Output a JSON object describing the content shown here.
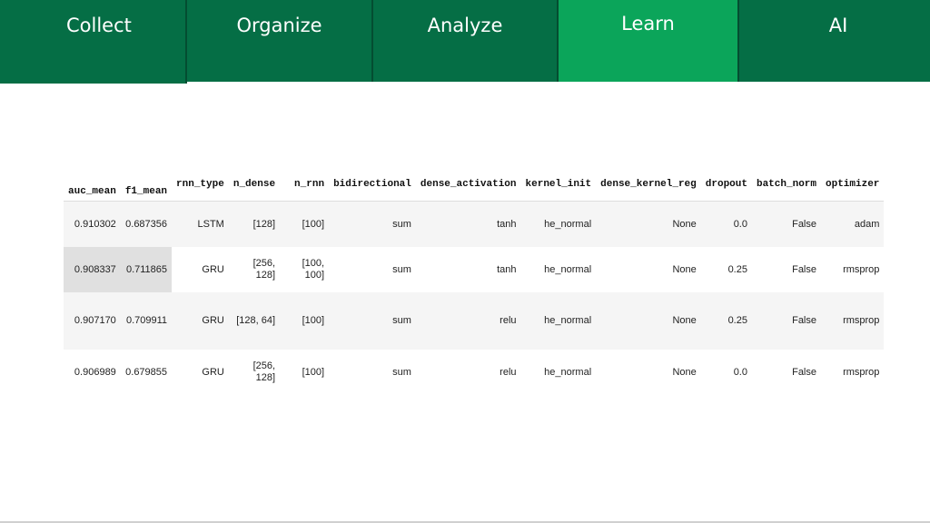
{
  "nav": {
    "tabs": [
      {
        "label": "Collect"
      },
      {
        "label": "Organize"
      },
      {
        "label": "Analyze"
      },
      {
        "label": "Learn"
      },
      {
        "label": "AI"
      }
    ],
    "active_tab": "Learn",
    "colors": {
      "tab_bg": "#056e45",
      "tab_active_bg": "#0ba55a",
      "text": "#ffffff"
    }
  },
  "table": {
    "columns": [
      "auc_mean",
      "f1_mean",
      "rnn_type",
      "n_dense",
      "n_rnn",
      "bidirectional",
      "dense_activation",
      "kernel_init",
      "dense_kernel_reg",
      "dropout",
      "batch_norm",
      "optimizer"
    ],
    "rows": [
      {
        "auc_mean": "0.910302",
        "f1_mean": "0.687356",
        "rnn_type": "LSTM",
        "n_dense": [
          "[128]"
        ],
        "n_rnn": [
          "[100]"
        ],
        "bidirectional": "sum",
        "dense_activation": "tanh",
        "kernel_init": "he_normal",
        "dense_kernel_reg": "None",
        "dropout": "0.0",
        "batch_norm": "False",
        "optimizer": "adam"
      },
      {
        "auc_mean": "0.908337",
        "f1_mean": "0.711865",
        "rnn_type": "GRU",
        "n_dense": [
          "[256,",
          "128]"
        ],
        "n_rnn": [
          "[100,",
          "100]"
        ],
        "bidirectional": "sum",
        "dense_activation": "tanh",
        "kernel_init": "he_normal",
        "dense_kernel_reg": "None",
        "dropout": "0.25",
        "batch_norm": "False",
        "optimizer": "rmsprop"
      },
      {
        "auc_mean": "0.907170",
        "f1_mean": "0.709911",
        "rnn_type": "GRU",
        "n_dense": [
          "[128, 64]"
        ],
        "n_rnn": [
          "[100]"
        ],
        "bidirectional": "sum",
        "dense_activation": "relu",
        "kernel_init": "he_normal",
        "dense_kernel_reg": "None",
        "dropout": "0.25",
        "batch_norm": "False",
        "optimizer": "rmsprop"
      },
      {
        "auc_mean": "0.906989",
        "f1_mean": "0.679855",
        "rnn_type": "GRU",
        "n_dense": [
          "[256,",
          "128]"
        ],
        "n_rnn": [
          "[100]"
        ],
        "bidirectional": "sum",
        "dense_activation": "relu",
        "kernel_init": "he_normal",
        "dense_kernel_reg": "None",
        "dropout": "0.0",
        "batch_norm": "False",
        "optimizer": "rmsprop"
      }
    ]
  }
}
